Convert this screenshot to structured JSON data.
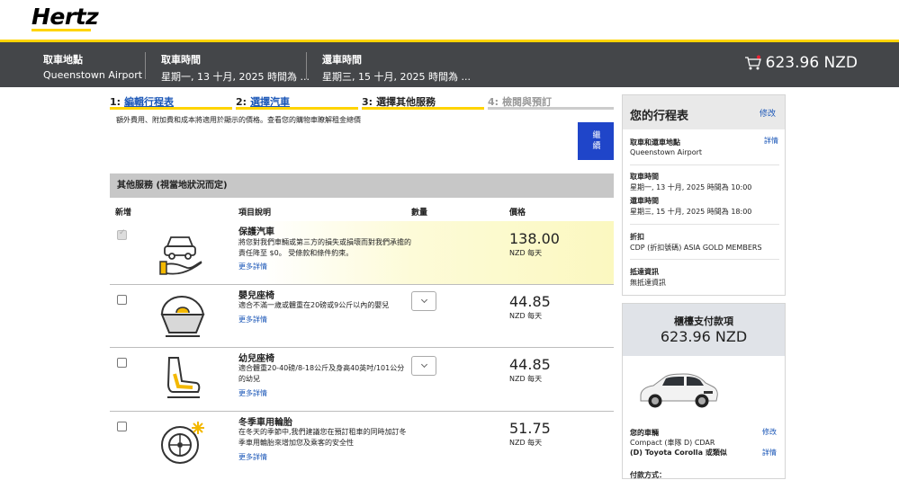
{
  "header": {
    "logo": "Hertz",
    "pickup_location_label": "取車地點",
    "pickup_location_value": "Queenstown Airport",
    "pickup_time_label": "取車時間",
    "pickup_time_value": "星期一, 13 十月, 2025 時間為 ...",
    "return_time_label": "還車時間",
    "return_time_value": "星期三, 15 十月, 2025 時間為 ...",
    "cart_total": "623.96 NZD"
  },
  "steps": [
    {
      "num": "1:",
      "label": "編輯行程表",
      "state": "link"
    },
    {
      "num": "2:",
      "label": "選擇汽車",
      "state": "link"
    },
    {
      "num": "3:",
      "label": "選擇其他服務",
      "state": "current"
    },
    {
      "num": "4:",
      "label": "檢閱與預訂",
      "state": "upcoming"
    }
  ],
  "notice": "額外費用、附加費和成本將適用於顯示的價格。查看您的購物車瞭解租金總價",
  "continue_button": "繼續",
  "services": {
    "heading": "其他服務 (視當地狀況而定)",
    "columns": [
      "新增",
      "項目說明",
      "數量",
      "價格"
    ],
    "rows": [
      {
        "title": "保護汽車",
        "desc": "將您對我們車輛或第三方的損失或損壞而對我們承擔的責任降至 $0。 受條款和條件約束。",
        "link": "更多詳情",
        "price": "138.00",
        "unit": "NZD 每天",
        "checked": true,
        "icon": "car-protection-icon"
      },
      {
        "title": "嬰兒座椅",
        "desc": "適合不滿一歲或體重在20磅或9公斤以內的嬰兒",
        "link": "更多詳情",
        "price": "44.85",
        "unit": "NZD 每天",
        "checked": false,
        "icon": "infant-seat-icon"
      },
      {
        "title": "幼兒座椅",
        "desc": "適合體重20-40磅/8-18公斤及身高40英吋/101公分的幼兒",
        "link": "更多詳情",
        "price": "44.85",
        "unit": "NZD 每天",
        "checked": false,
        "icon": "child-seat-icon"
      },
      {
        "title": "冬季車用輪胎",
        "desc": "在冬天的季節中,我們建議您在預訂租車的同時加訂冬季車用輪胎來增加您及乘客的安全性",
        "link": "更多詳情",
        "price": "51.75",
        "unit": "NZD 每天",
        "checked": false,
        "icon": "winter-tire-icon"
      }
    ]
  },
  "itinerary": {
    "title": "您的行程表",
    "edit": "修改",
    "location_label": "取車和還車地點",
    "details": "詳情",
    "location_value": "Queenstown Airport",
    "pickup_label": "取車時間",
    "pickup_value": "星期一, 13 十月, 2025 時間為 10:00",
    "return_label": "還車時間",
    "return_value": "星期三, 15 十月, 2025 時間為 18:00",
    "discount_label": "折扣",
    "discount_value": "CDP (折扣號碼) ASIA GOLD MEMBERS",
    "arrival_label": "抵達資訊",
    "arrival_value": "無抵達資訊"
  },
  "payment": {
    "title": "櫃檯支付款項",
    "amount": "623.96 NZD",
    "car_label": "您的車輛",
    "car_edit": "修改",
    "car_class": "Compact (車隊 D) CDAR",
    "car_model": "(D) Toyota Corolla 或類似",
    "car_details": "詳情",
    "method_label": "付款方式："
  },
  "colors": {
    "brand_yellow": "#ffd400",
    "header_dark": "#444649",
    "link_blue": "#1a56b7",
    "button_blue": "#1f45c9"
  }
}
